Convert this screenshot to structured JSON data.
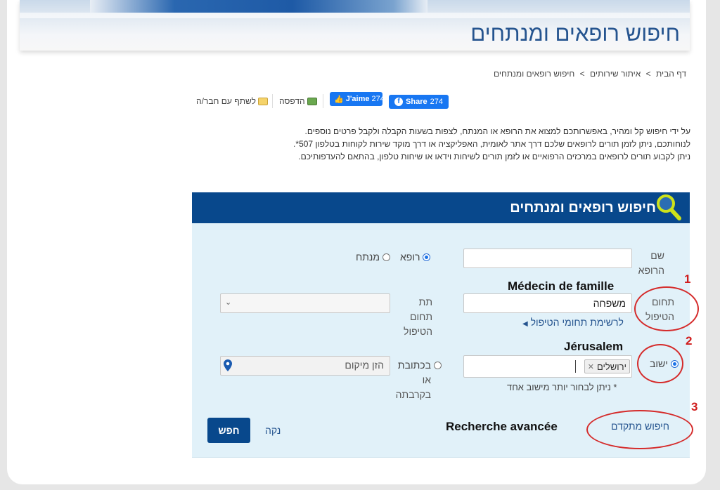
{
  "header": {
    "title": "חיפוש רופאים ומנתחים"
  },
  "breadcrumb": {
    "items": [
      "דף הבית",
      "איתור שירותים",
      "חיפוש רופאים ומנתחים"
    ],
    "separator": ">"
  },
  "share": {
    "fb_share_label": "Share",
    "fb_share_count": "274",
    "fb_like_label": "J'aime",
    "fb_like_count": "274",
    "print_label": "הדפסה",
    "share_friend_label": "לשתף עם חבר/ה"
  },
  "intro": {
    "line1": "על ידי חיפוש קל ומהיר, באפשרותכם למצוא את הרופא או המנתח, לצפות בשעות הקבלה ולקבל פרטים נוספים.",
    "line2": "לנוחותכם, ניתן לזמן תורים לרופאים שלכם דרך אתר לאומית, האפליקציה או דרך מוקד שירות לקוחות בטלפון 507*.",
    "line3": "ניתן לקבוע תורים לרופאים במרכזים הרפואיים או לזמן תורים לשיחות וידאו או שיחות טלפון, בהתאם להעדפותיכם."
  },
  "search_panel": {
    "title": "חיפוש רופאים ומנתחים",
    "doctor_name_label_1": "שם",
    "doctor_name_label_2": "הרופא",
    "doctor_name_value": "",
    "type_doctor": "רופא",
    "type_surgeon": "מנתח",
    "specialty_label_1": "תחום",
    "specialty_label_2": "הטיפול",
    "specialty_value": "משפחה",
    "specialty_annotation": "Médecin de famille",
    "specialty_list_link": "לרשימת תחומי הטיפול",
    "subspecialty_label_1": "תת",
    "subspecialty_label_2": "תחום",
    "subspecialty_label_3": "הטיפול",
    "settlement_label": "ישוב",
    "settlement_tag": "ירושלים",
    "settlement_annotation": "Jérusalem",
    "settlement_note": "* ניתן לבחור יותר מישוב אחד",
    "address_label_1": "בכתובת",
    "address_label_2": "או",
    "address_label_3": "בקרבתה",
    "address_placeholder": "הזן מיקום",
    "advanced_search_link": "חיפוש מתקדם",
    "advanced_search_annotation": "Recherche avancée",
    "clear_label": "נקה",
    "search_label": "חפש"
  },
  "annotations": {
    "num1": "1",
    "num2": "2",
    "num3": "3"
  },
  "colors": {
    "brand_blue": "#08488c",
    "panel_bg": "#e1f1f9",
    "link_blue": "#25548f",
    "annotation_red": "#d01c1c"
  }
}
